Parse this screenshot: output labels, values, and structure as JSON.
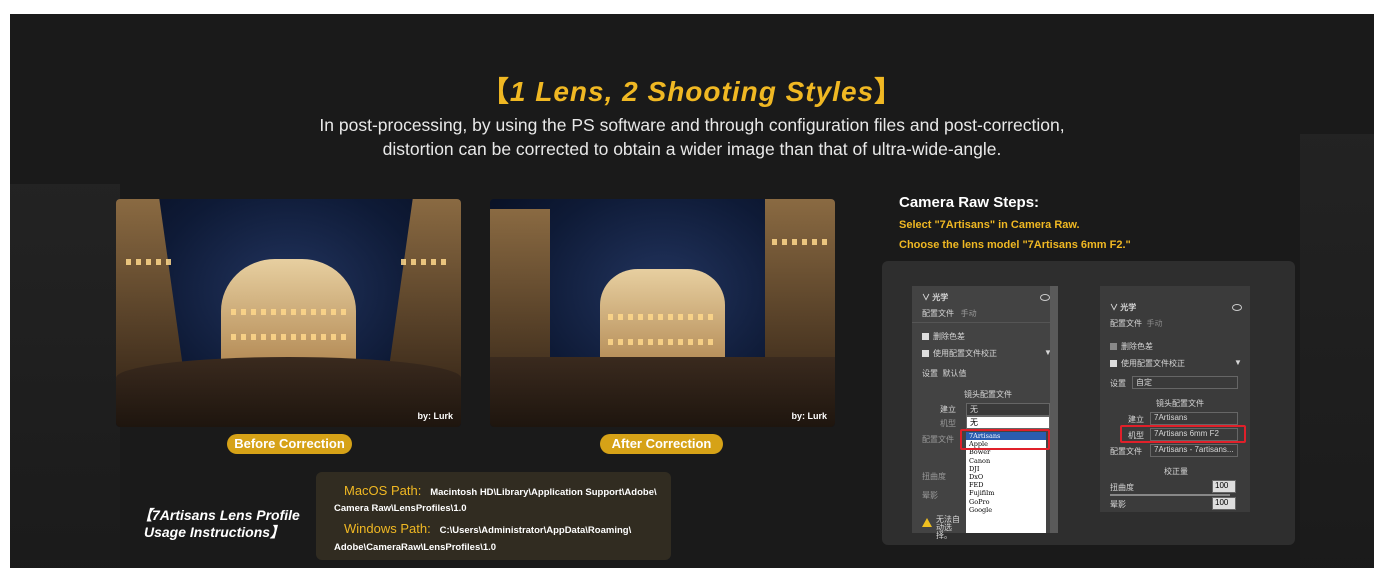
{
  "title": {
    "bracket_open": "【",
    "text": "1 Lens, 2 Shooting Styles",
    "bracket_close": "】"
  },
  "subtitle": {
    "line1": "In post-processing, by using the PS software and through configuration files and post-correction,",
    "line2": "distortion can be corrected to obtain a wider image than that of ultra-wide-angle."
  },
  "photos": {
    "before": {
      "credit": "by: Lurk",
      "label": "Before Correction"
    },
    "after": {
      "credit": "by: Lurk",
      "label": "After Correction"
    }
  },
  "steps": {
    "title": "Camera Raw Steps:",
    "step1": "Select \"7Artisans\" in Camera Raw.",
    "step2": "Choose the lens model \"7Artisans 6mm F2.\""
  },
  "ps_left": {
    "section": "光学",
    "tab_profile": "配置文件",
    "tab_manual": "手动",
    "remove_ca": "删除色差",
    "use_profile": "使用配置文件校正",
    "setting_label": "设置",
    "setting_value": "默认值",
    "lens_profile": "镜头配置文件",
    "make_label": "建立",
    "make_value": "无",
    "model_label": "机型",
    "model_value": "无",
    "profile_label": "配置文件",
    "distortion_label": "扭曲度",
    "vignette_label": "晕影",
    "warning": "无法自动选择。",
    "list": [
      "7Artisans",
      "Apple",
      "Bower",
      "Canon",
      "DJI",
      "DxO",
      "FED",
      "Fujifilm",
      "GoPro",
      "Google"
    ]
  },
  "ps_right": {
    "section": "光学",
    "tab_profile": "配置文件",
    "tab_manual": "手动",
    "remove_ca": "删除色差",
    "use_profile": "使用配置文件校正",
    "setting_label": "设置",
    "setting_value": "自定",
    "lens_profile": "镜头配置文件",
    "make_label": "建立",
    "make_value": "7Artisans",
    "model_label": "机型",
    "model_value": "7Artisans 6mm F2",
    "profile_label": "配置文件",
    "profile_value": "7Artisans - 7artisans...",
    "correction": "校正量",
    "distortion_label": "扭曲度",
    "distortion_value": "100",
    "vignette_label": "晕影",
    "vignette_value": "100"
  },
  "paths": {
    "mac_label": "MacOS Path:",
    "mac_value1": "Macintosh HD\\Library\\Application Support\\Adobe\\",
    "mac_value2": "Camera Raw\\LensProfiles\\1.0",
    "win_label": "Windows Path:",
    "win_value1": "C:\\Users\\Administrator\\AppData\\Roaming\\",
    "win_value2": "Adobe\\CameraRaw\\LensProfiles\\1.0"
  },
  "lens_profile_title": {
    "line1": "【7Artisans Lens Profile",
    "line2": "Usage Instructions】"
  },
  "colors": {
    "accent": "#f0b823",
    "background": "#1a1a1a",
    "highlight_red": "#e0202a"
  }
}
